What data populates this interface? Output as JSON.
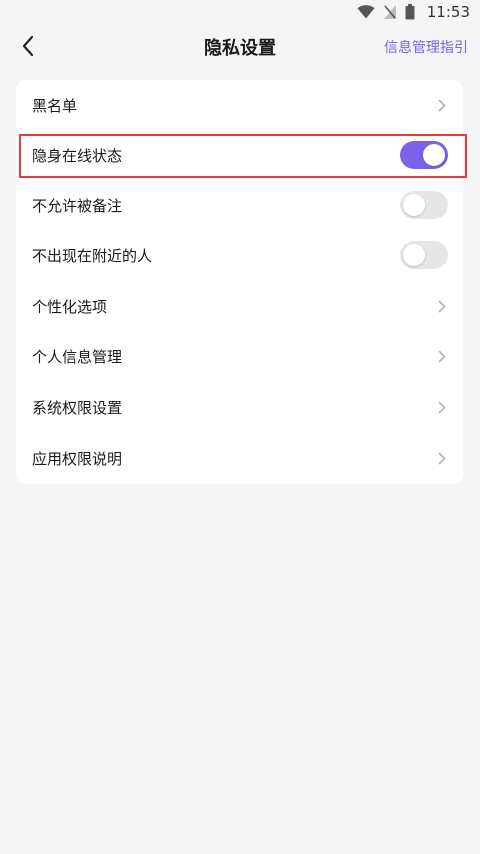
{
  "status_bar": {
    "time": "11:53",
    "icons": [
      "wifi-icon",
      "no-signal-icon",
      "battery-icon"
    ]
  },
  "header": {
    "back_icon": "back-arrow-icon",
    "title": "隐私设置",
    "link": "信息管理指引"
  },
  "settings": {
    "items": [
      {
        "label": "黑名单",
        "type": "link"
      },
      {
        "label": "隐身在线状态",
        "type": "toggle",
        "enabled": true
      },
      {
        "label": "不允许被备注",
        "type": "toggle",
        "enabled": false
      },
      {
        "label": "不出现在附近的人",
        "type": "toggle",
        "enabled": false
      },
      {
        "label": "个性化选项",
        "type": "link"
      },
      {
        "label": "个人信息管理",
        "type": "link"
      },
      {
        "label": "系统权限设置",
        "type": "link"
      },
      {
        "label": "应用权限说明",
        "type": "link"
      }
    ]
  },
  "colors": {
    "accent": "#7b62e8",
    "toggle_off": "#e6e6e6",
    "highlight": "#e53935",
    "background": "#f5f5f5",
    "card": "#ffffff"
  }
}
